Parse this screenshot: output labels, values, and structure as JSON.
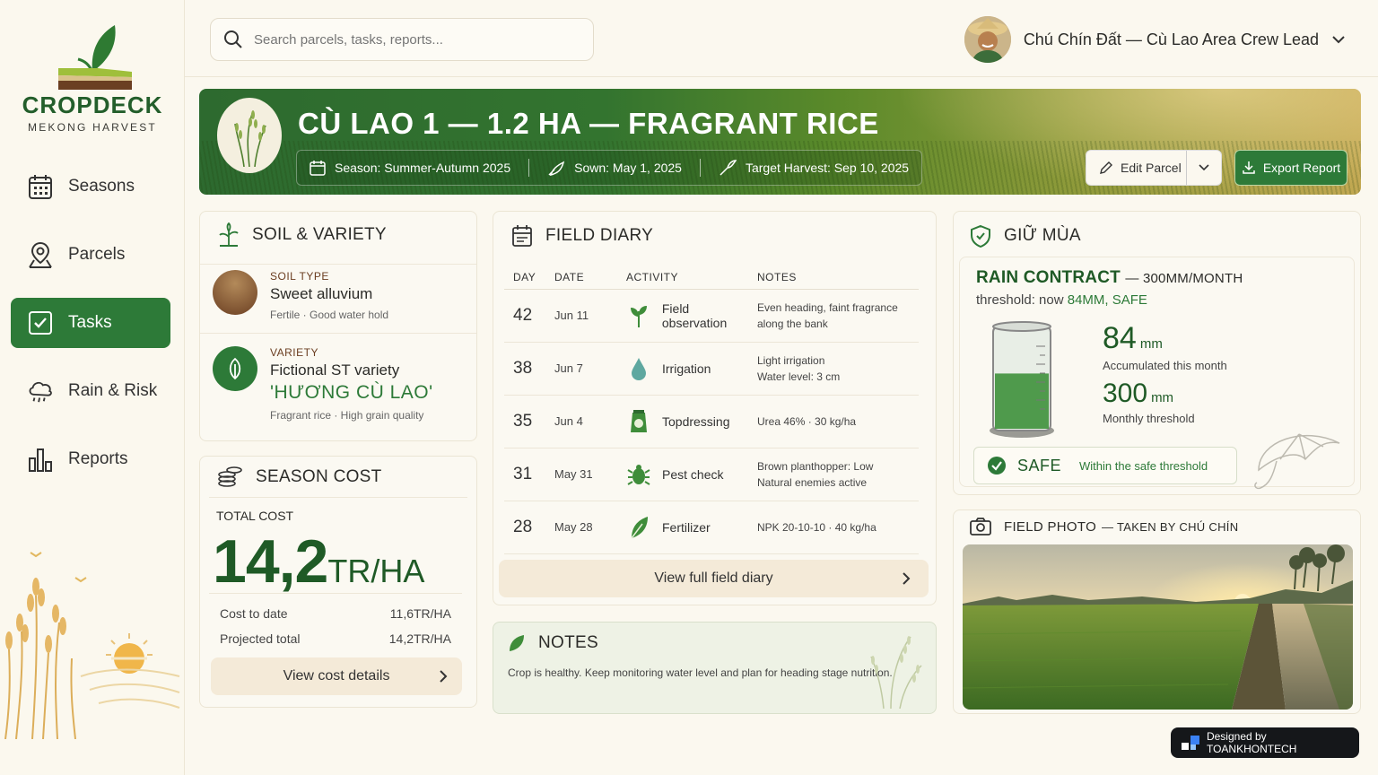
{
  "brand": {
    "name": "CROPDECK",
    "tagline": "MEKONG HARVEST"
  },
  "nav": [
    {
      "label": "Seasons",
      "icon": "calendar-icon",
      "active": false
    },
    {
      "label": "Parcels",
      "icon": "map-pin-icon",
      "active": false
    },
    {
      "label": "Tasks",
      "icon": "checkbox-icon",
      "active": true
    },
    {
      "label": "Rain & Risk",
      "icon": "rain-cloud-icon",
      "active": false
    },
    {
      "label": "Reports",
      "icon": "bar-chart-icon",
      "active": false
    }
  ],
  "search": {
    "placeholder": "Search parcels, tasks, reports..."
  },
  "user": {
    "name": "Chú Chín Đất — Cù Lao Area Crew Lead"
  },
  "hero": {
    "title": "CÙ LAO 1 — 1.2 HA — FRAGRANT RICE",
    "season": "Season: Summer-Autumn 2025",
    "sown": "Sown: May 1, 2025",
    "harvest": "Target Harvest: Sep 10, 2025",
    "edit_label": "Edit Parcel",
    "export_label": "Export Report"
  },
  "soil": {
    "title": "SOIL & VARIETY",
    "soil_label": "SOIL TYPE",
    "soil_value": "Sweet alluvium",
    "soil_sub_1": "Fertile",
    "soil_sub_2": "Good water hold",
    "variety_label": "VARIETY",
    "variety_value": "Fictional ST variety",
    "variety_name": "'HƯƠNG CÙ LAO'",
    "variety_sub": "Fragrant rice · High grain quality"
  },
  "cost": {
    "title": "SEASON COST",
    "total_label": "TOTAL COST",
    "total_value": "14,2",
    "total_unit": "TR/HA",
    "to_date_label": "Cost to date",
    "to_date_value": "11,6TR/HA",
    "projected_label": "Projected total",
    "projected_value": "14,2TR/HA",
    "button": "View cost details"
  },
  "diary": {
    "title": "FIELD DIARY",
    "columns": [
      "DAY",
      "DATE",
      "ACTIVITY",
      "NOTES"
    ],
    "rows": [
      {
        "day": "42",
        "date": "Jun 11",
        "activity": "Field observation",
        "icon": "leaf-sprout-icon",
        "notes_1": "Even heading, faint fragrance",
        "notes_2": "along the bank"
      },
      {
        "day": "38",
        "date": "Jun 7",
        "activity": "Irrigation",
        "icon": "water-drop-icon",
        "notes_1": "Light irrigation",
        "notes_2": "Water level: 3 cm"
      },
      {
        "day": "35",
        "date": "Jun 4",
        "activity": "Topdressing",
        "icon": "fertilizer-bag-icon",
        "notes_1": "Urea 46% · 30 kg/ha",
        "notes_2": ""
      },
      {
        "day": "31",
        "date": "May 31",
        "activity": "Pest check",
        "icon": "bug-icon",
        "notes_1": "Brown planthopper: Low",
        "notes_2": "Natural enemies active"
      },
      {
        "day": "28",
        "date": "May 28",
        "activity": "Fertilizer",
        "icon": "leaf-icon",
        "notes_1": "NPK 20-10-10 · 40 kg/ha",
        "notes_2": ""
      }
    ],
    "button": "View full field diary"
  },
  "notes": {
    "title": "NOTES",
    "text": "Crop is healthy. Keep monitoring water level and plan for heading stage nutrition."
  },
  "giu_mua": {
    "title": "GIỮ MÙA",
    "contract_title": "RAIN CONTRACT",
    "contract_detail": "— 300MM/MONTH",
    "threshold_prefix": "threshold: now",
    "threshold_status": "84MM, SAFE",
    "accumulated_value": "84",
    "accumulated_unit": "mm",
    "accumulated_label": "Accumulated this month",
    "threshold_value": "300",
    "threshold_unit": "mm",
    "threshold_label": "Monthly threshold",
    "fill_fraction": 0.28,
    "status": "SAFE",
    "status_desc": "Within the safe threshold"
  },
  "photo": {
    "title": "FIELD PHOTO",
    "subtitle": "— TAKEN BY CHÚ CHÍN"
  },
  "credit": "Designed by TOANKHONTECH",
  "colors": {
    "primary": "#2d7a38",
    "dark_green": "#1f5a26",
    "cream": "#fbf8ef",
    "accent_brown": "#6a3d20"
  }
}
